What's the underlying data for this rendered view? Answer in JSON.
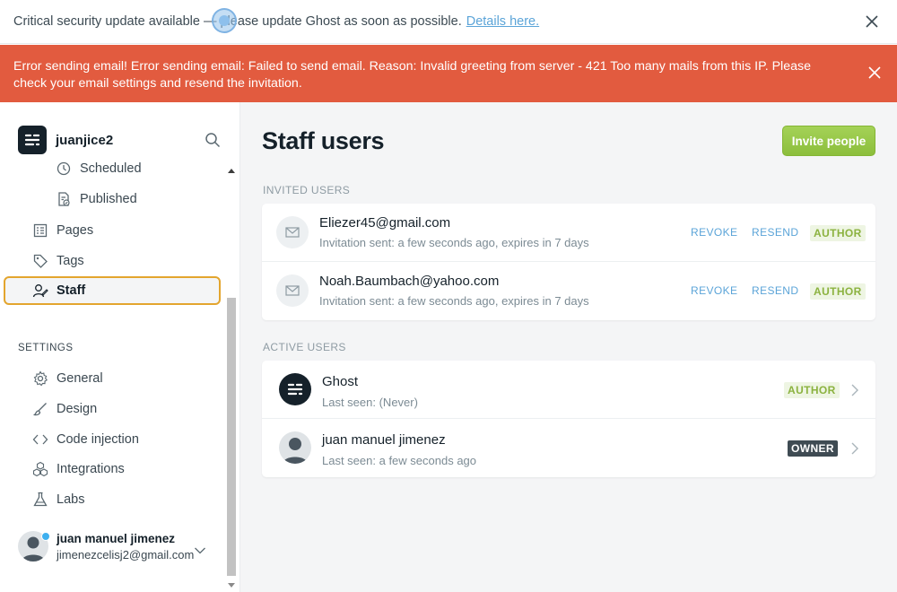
{
  "notification": {
    "text": "Critical security update available — please update Ghost as soon as possible.",
    "link": "Details here."
  },
  "alert": {
    "text": "Error sending email! Error sending email: Failed to send email. Reason: Invalid greeting from server - 421 Too many mails from this IP. Please check your email settings and resend the invitation."
  },
  "sidebar": {
    "site_name": "juanjice2",
    "nav": [
      {
        "label": "Scheduled",
        "icon": "clock-icon"
      },
      {
        "label": "Published",
        "icon": "published-icon"
      },
      {
        "label": "Pages",
        "icon": "pages-icon"
      },
      {
        "label": "Tags",
        "icon": "tag-icon"
      },
      {
        "label": "Staff",
        "icon": "staff-icon",
        "active": true
      }
    ],
    "settings_label": "SETTINGS",
    "settings": [
      {
        "label": "General",
        "icon": "gear-icon"
      },
      {
        "label": "Design",
        "icon": "brush-icon"
      },
      {
        "label": "Code injection",
        "icon": "code-icon"
      },
      {
        "label": "Integrations",
        "icon": "integrations-icon"
      },
      {
        "label": "Labs",
        "icon": "flask-icon"
      }
    ],
    "user": {
      "name": "juan manuel jimenez",
      "email": "jimenezcelisj2@gmail.com"
    }
  },
  "main": {
    "title": "Staff users",
    "invite_label": "Invite people",
    "invited_label": "INVITED USERS",
    "active_label": "ACTIVE USERS",
    "invited": [
      {
        "email": "Eliezer45@gmail.com",
        "status": "Invitation sent: a few seconds ago, expires in 7 days",
        "revoke": "REVOKE",
        "resend": "RESEND",
        "role": "AUTHOR"
      },
      {
        "email": "Noah.Baumbach@yahoo.com",
        "status": "Invitation sent: a few seconds ago, expires in 7 days",
        "revoke": "REVOKE",
        "resend": "RESEND",
        "role": "AUTHOR"
      }
    ],
    "active": [
      {
        "name": "Ghost",
        "seen": "Last seen: (Never)",
        "role": "AUTHOR"
      },
      {
        "name": "juan manuel jimenez",
        "seen": "Last seen: a few seconds ago",
        "role": "OWNER"
      }
    ]
  },
  "colors": {
    "alert": "#e25b3f",
    "accent_green": "#9bc94e",
    "link_blue": "#5ba4d8",
    "focus_ring": "#e3a52e"
  }
}
